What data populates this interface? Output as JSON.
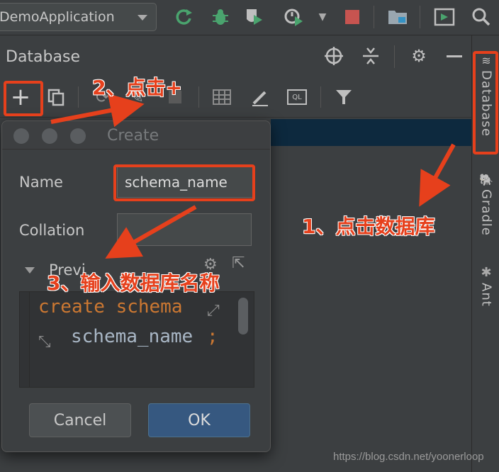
{
  "toolbar": {
    "run_config": "DemoApplication",
    "icons": [
      "refresh-icon",
      "bug-icon",
      "coverage-icon",
      "profiler-icon",
      "stop-icon",
      "project-structure-icon",
      "terminal-icon",
      "search-icon"
    ]
  },
  "database_panel": {
    "title": "Database",
    "toolbar_icons": [
      "add-icon",
      "copy-icon",
      "refresh-icon",
      "edit-icon",
      "stop-icon",
      "table-icon",
      "pen-icon",
      "ql-console-icon",
      "filter-icon"
    ],
    "ql_label": "QL"
  },
  "right_stripe": {
    "tabs": [
      {
        "label": "Database",
        "icon": "database-icon"
      },
      {
        "label": "Gradle",
        "icon": "gradle-icon"
      },
      {
        "label": "Ant",
        "icon": "ant-icon"
      }
    ]
  },
  "create_dialog": {
    "title": "Create",
    "name_label": "Name",
    "name_value": "schema_name",
    "collation_label": "Collation",
    "collation_value": "",
    "preview_label": "Previ",
    "preview_code": {
      "line1_keyword": "create schema",
      "line2_ident": "schema_name",
      "line2_punct": ";"
    },
    "cancel_label": "Cancel",
    "ok_label": "OK"
  },
  "annotations": {
    "step1": "1、点击数据库",
    "step2": "2、点击+",
    "step3": "3、输入数据库名称",
    "color": "#e6401c"
  },
  "watermark": "https://blog.csdn.net/yoonerloop"
}
